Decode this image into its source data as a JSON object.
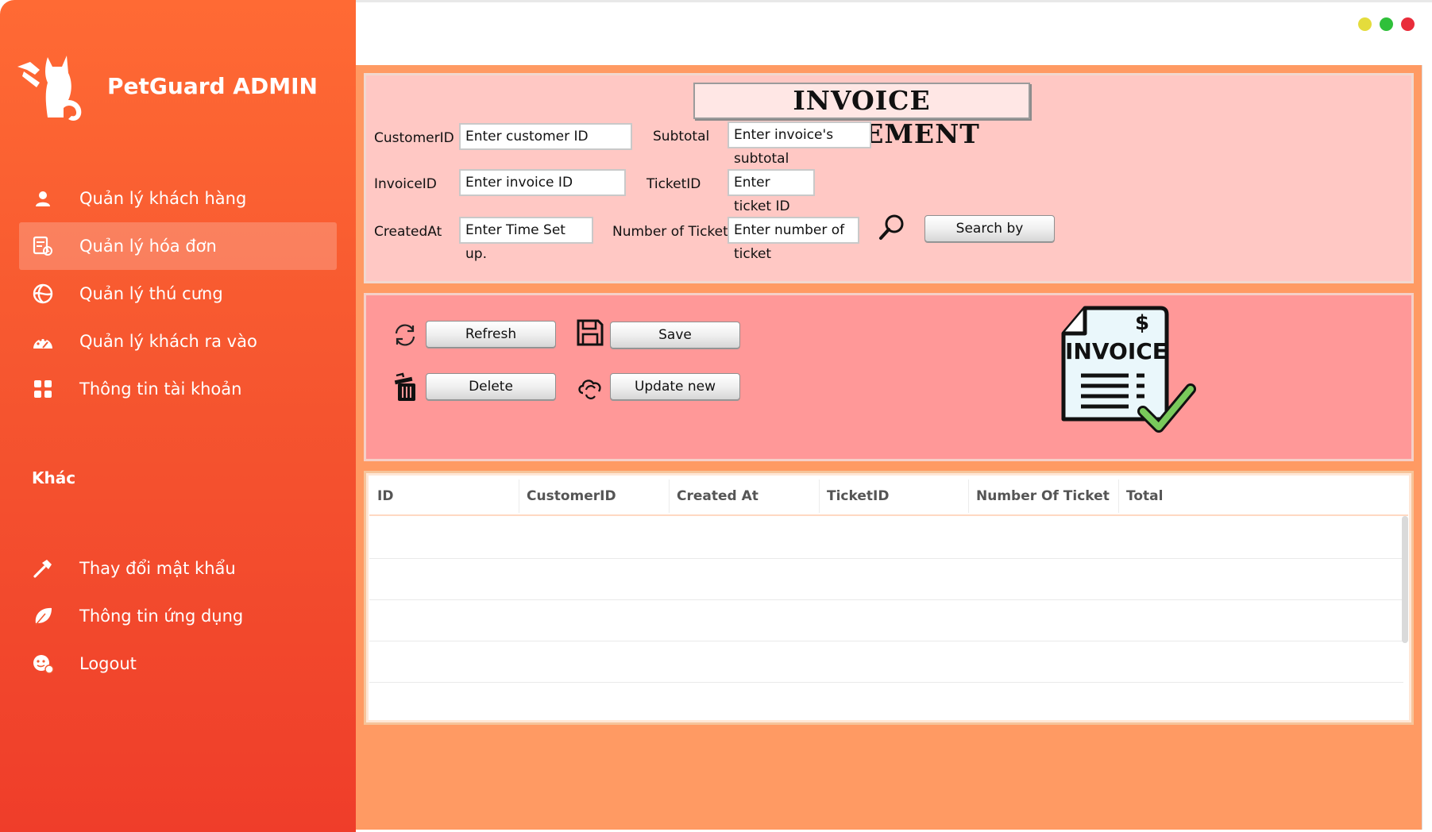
{
  "app": {
    "title": "PetGuard ADMIN",
    "brand_logo_icon": "cat-with-hand-logo"
  },
  "sidebar": {
    "items": [
      {
        "label": "Quản lý khách hàng",
        "icon": "user-icon",
        "active": false
      },
      {
        "label": "Quản lý hóa đơn",
        "icon": "invoice-icon",
        "active": true
      },
      {
        "label": "Quản lý thú cưng",
        "icon": "pet-icon",
        "active": false
      },
      {
        "label": "Quản lý khách ra vào",
        "icon": "dashboard-gauge-icon",
        "active": false
      },
      {
        "label": "Thông tin tài khoản",
        "icon": "grid-icon",
        "active": false
      }
    ],
    "section_label": "Khác",
    "other_items": [
      {
        "label": "Thay đổi mật khẩu",
        "icon": "hammer-icon"
      },
      {
        "label": "Thông tin ứng dụng",
        "icon": "leaf-icon"
      },
      {
        "label": "Logout",
        "icon": "logout-face-icon"
      }
    ]
  },
  "window": {
    "controls": [
      "minimize",
      "maximize",
      "close"
    ],
    "colors": {
      "minimize": "#e4dc3c",
      "maximize": "#2fc03a",
      "close": "#e92c3a"
    }
  },
  "form": {
    "heading": "INVOICE MANAGEMENT",
    "fields": {
      "customer_id": {
        "label": "CustomerID",
        "value": "Enter customer ID"
      },
      "subtotal": {
        "label": "Subtotal",
        "value": "Enter invoice's subtotal"
      },
      "invoice_id": {
        "label": "InvoiceID",
        "value": "Enter invoice ID"
      },
      "ticket_id": {
        "label": "TicketID",
        "value": "Enter ticket ID"
      },
      "created_at": {
        "label": "CreatedAt",
        "value": "Enter Time Set up."
      },
      "number_of_ticket": {
        "label": "Number of Ticket",
        "value": "Enter number of ticket"
      }
    },
    "search_button": "Search by",
    "search_icon": "magnifier-icon"
  },
  "actions": {
    "refresh": "Refresh",
    "save": "Save",
    "delete": "Delete",
    "update": "Update new",
    "illustration_text": "INVOICE",
    "illustration_symbol": "$"
  },
  "table": {
    "columns": [
      "ID",
      "CustomerID",
      "Created At",
      "TicketID",
      "Number Of Ticket",
      "Total"
    ],
    "rows": []
  },
  "colors": {
    "sidebar_top": "#ff6a34",
    "sidebar_bottom": "#ef3d2a",
    "content_bg": "#ff9a63",
    "form_panel": "#ffc8c4",
    "action_panel": "#ff9898"
  }
}
